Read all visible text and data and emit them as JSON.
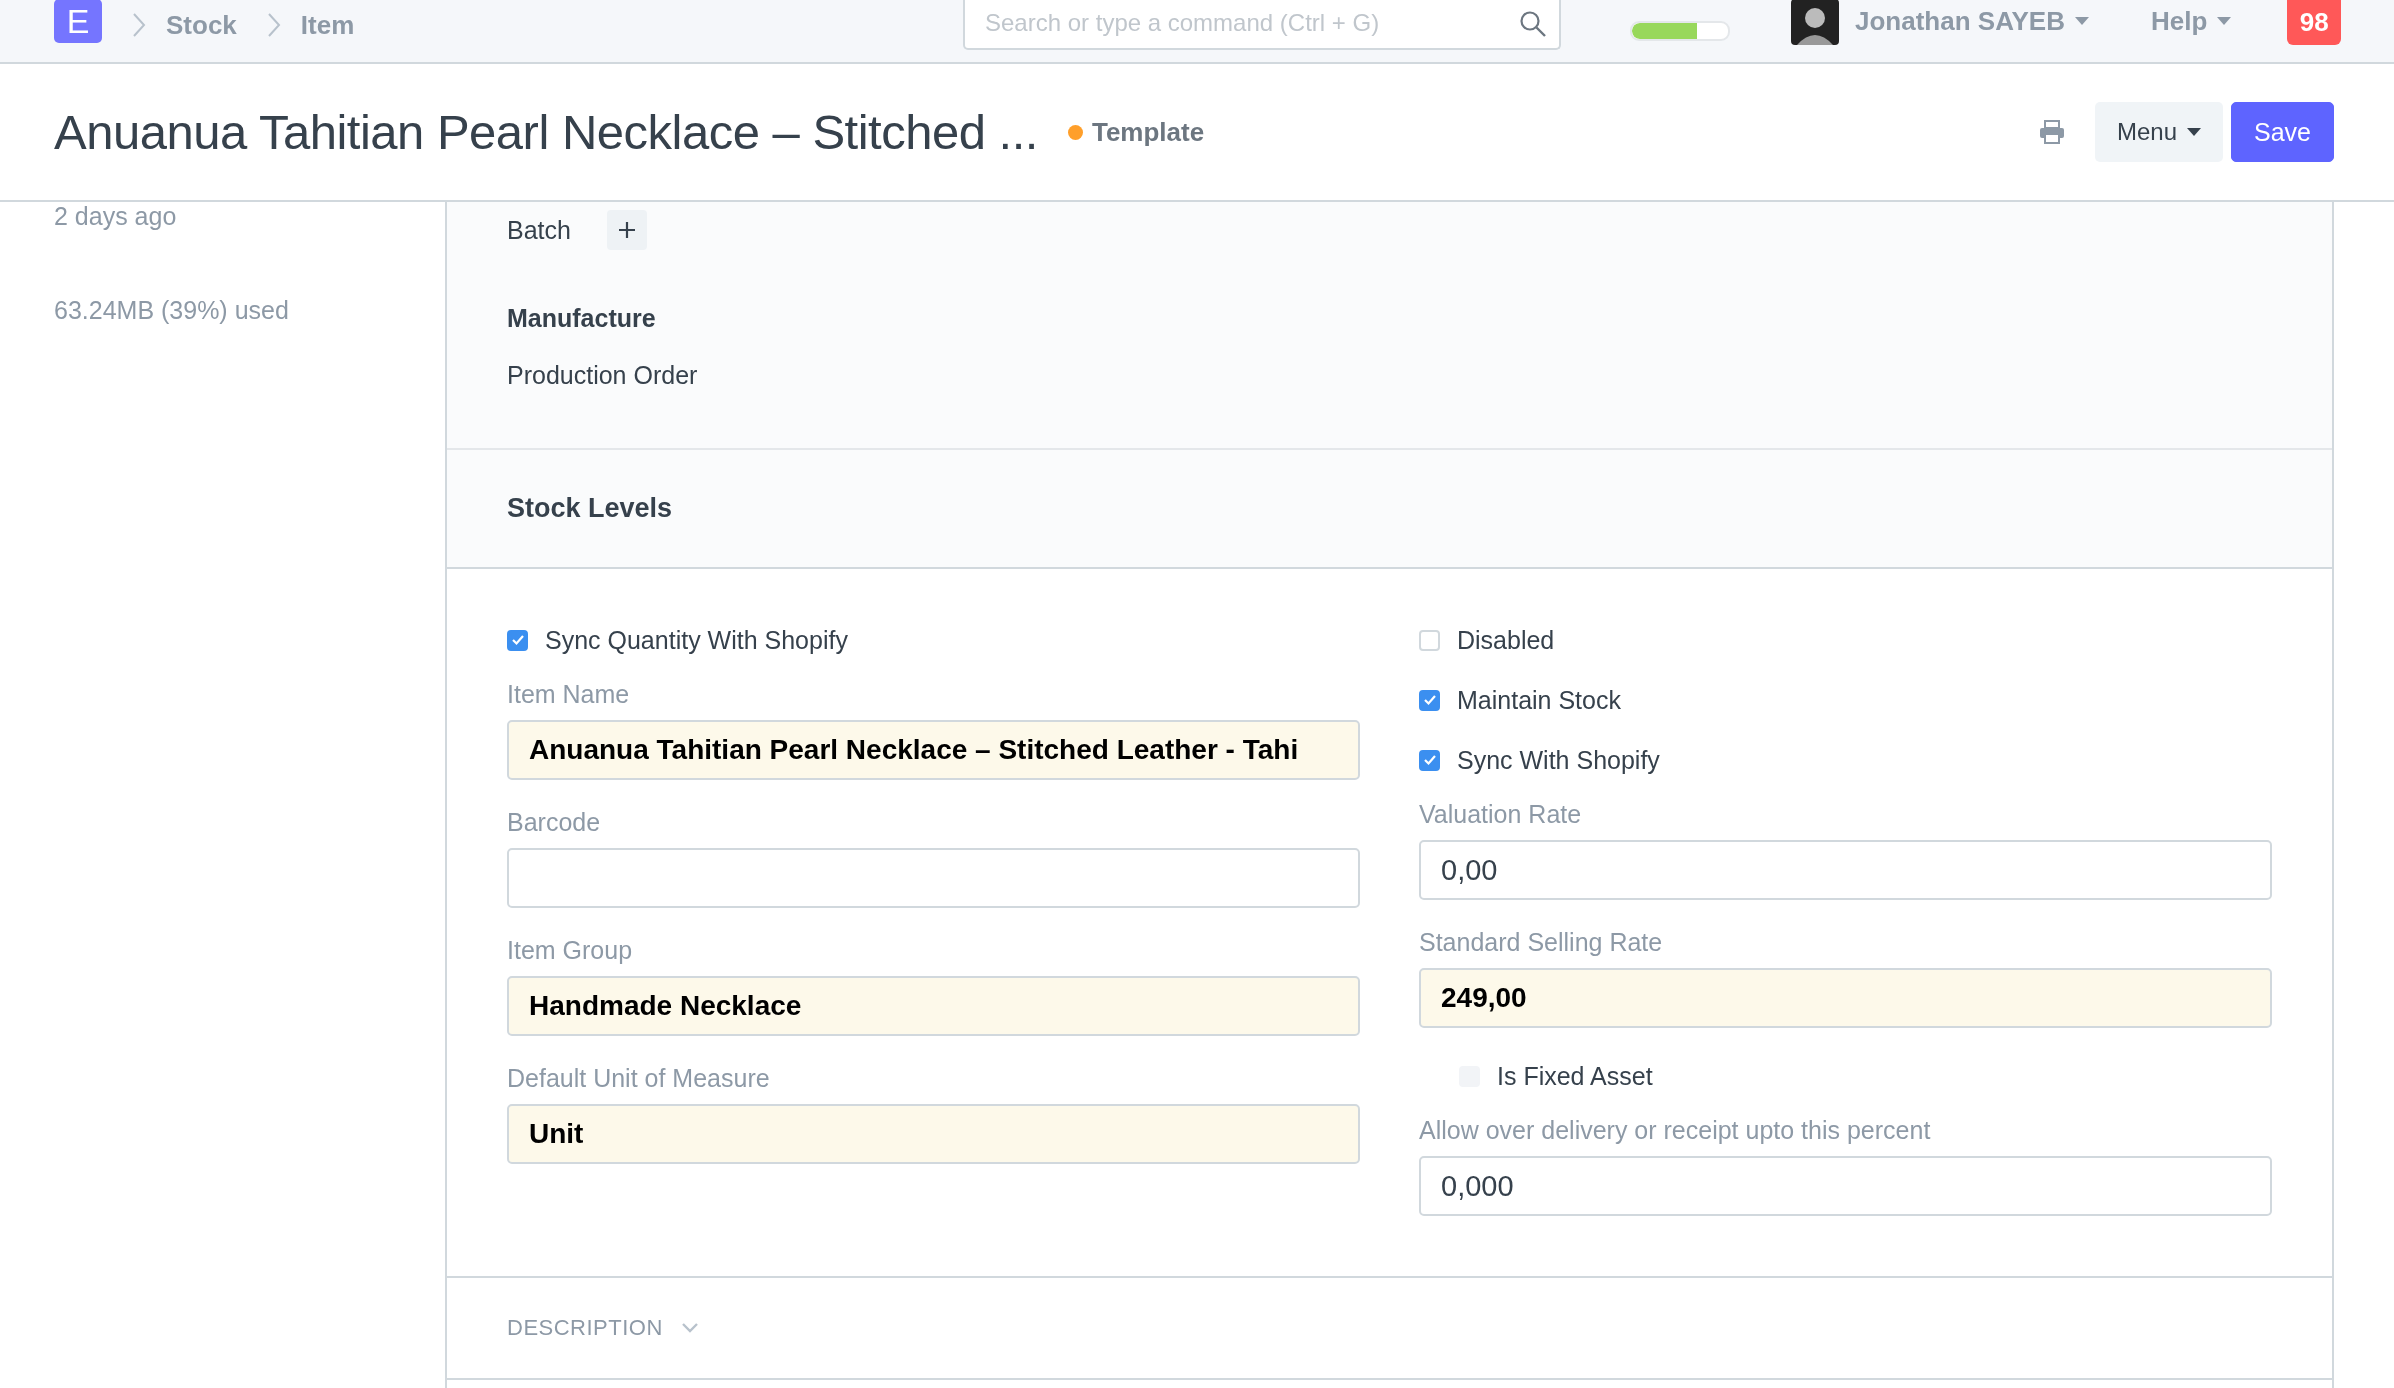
{
  "navbar": {
    "logo": "E",
    "breadcrumbs": [
      "Stock",
      "Item"
    ],
    "search": {
      "placeholder": "Search or type a command (Ctrl + G)"
    },
    "progress": {
      "level": 0.68
    },
    "user": "Jonathan SAYEB",
    "help": "Help",
    "notifications": "98"
  },
  "header": {
    "title": "Anuanua Tahitian Pearl Necklace – Stitched ...",
    "status": {
      "label": "Template",
      "color": "#ff9f2a"
    },
    "menu": "Menu",
    "save": "Save"
  },
  "sidebar": {
    "items": [
      "2 days ago",
      "63.24MB (39%) used"
    ]
  },
  "top_section": {
    "batch": "Batch",
    "manufacture": "Manufacture",
    "production_order": "Production Order"
  },
  "stock_levels": {
    "title": "Stock Levels"
  },
  "form": {
    "left": [
      {
        "kind": "checkbox",
        "label": "Sync Quantity With Shopify",
        "checked": true,
        "disabled": false
      },
      {
        "kind": "field",
        "label": "Item Name",
        "value": "Anuanua Tahitian Pearl Necklace – Stitched Leather - Tahi",
        "mandatory": true
      },
      {
        "kind": "field",
        "label": "Barcode",
        "mandatory": false
      },
      {
        "kind": "field",
        "label": "Item Group",
        "value": "Handmade Necklace",
        "mandatory": true
      },
      {
        "kind": "field",
        "label": "Default Unit of Measure",
        "value": "Unit",
        "mandatory": true
      }
    ],
    "right": [
      {
        "kind": "checkbox",
        "label": "Disabled",
        "checked": false,
        "disabled": false
      },
      {
        "kind": "checkbox",
        "label": "Maintain Stock",
        "checked": true,
        "disabled": false
      },
      {
        "kind": "checkbox",
        "label": "Sync With Shopify",
        "checked": true,
        "disabled": false
      },
      {
        "kind": "field",
        "label": "Valuation Rate",
        "value": "0,00",
        "mandatory": false
      },
      {
        "kind": "field",
        "label": "Standard Selling Rate",
        "value": "249,00",
        "mandatory": true
      },
      {
        "kind": "checkbox",
        "label": "Is Fixed Asset",
        "checked": false,
        "disabled": true
      },
      {
        "kind": "field",
        "label": "Allow over delivery or receipt upto this percent",
        "value": "0,000",
        "mandatory": false
      }
    ]
  },
  "description": {
    "title": "DESCRIPTION",
    "expanded": false
  }
}
